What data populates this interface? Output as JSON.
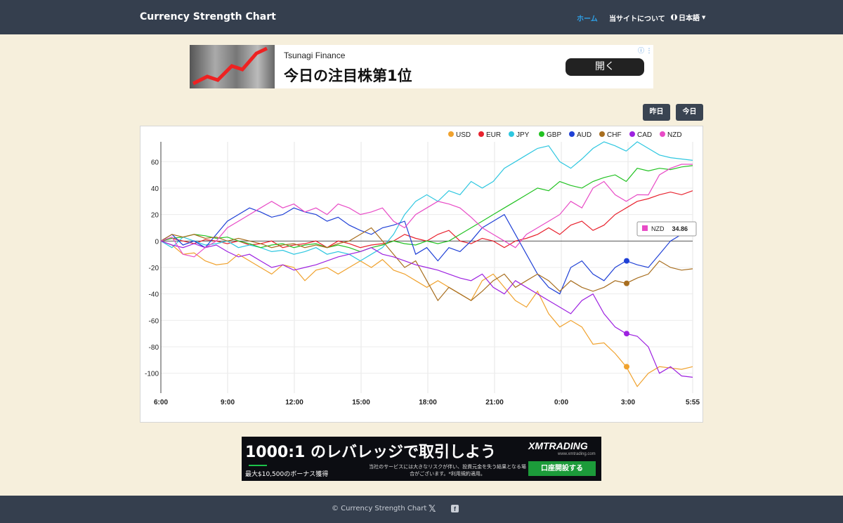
{
  "navbar": {
    "brand": "Currency Strength Chart",
    "links": [
      {
        "label": "ホーム",
        "active": true
      },
      {
        "label": "当サイトについて",
        "active": false
      }
    ],
    "language": "日本語"
  },
  "ad_top": {
    "brand": "Tsunagi Finance",
    "headline": "今日の注目株第1位",
    "button": "開く",
    "info_icon": "info-icon"
  },
  "buttons": {
    "yesterday": "昨日",
    "today": "今日"
  },
  "chart_data": {
    "type": "line",
    "x_ticks": [
      "6:00",
      "9:00",
      "12:00",
      "15:00",
      "18:00",
      "21:00",
      "0:00",
      "3:00",
      "5:55"
    ],
    "y_ticks": [
      60,
      40,
      20,
      0,
      -20,
      -40,
      -60,
      -80,
      -100
    ],
    "ylim": [
      -115,
      75
    ],
    "grid": true,
    "legend_position": "top-right",
    "tooltip": {
      "series": "NZD",
      "value": "34.86"
    },
    "series": [
      {
        "name": "USD",
        "color": "#f0a22e",
        "values": [
          0,
          -3,
          -10,
          -9,
          -15,
          -18,
          -17,
          -10,
          -15,
          -20,
          -25,
          -18,
          -20,
          -30,
          -22,
          -20,
          -25,
          -20,
          -15,
          -20,
          -14,
          -22,
          -25,
          -30,
          -35,
          -30,
          -35,
          -40,
          -45,
          -30,
          -25,
          -35,
          -45,
          -50,
          -38,
          -55,
          -65,
          -60,
          -65,
          -78,
          -77,
          -85,
          -95,
          -110,
          -100,
          -95,
          -96,
          -97,
          -95
        ]
      },
      {
        "name": "EUR",
        "color": "#e8222e",
        "values": [
          0,
          2,
          0,
          -2,
          1,
          0,
          -2,
          0,
          -3,
          -2,
          0,
          -5,
          -3,
          -2,
          0,
          -5,
          0,
          -2,
          -5,
          -3,
          -2,
          0,
          5,
          2,
          0,
          5,
          8,
          0,
          -2,
          2,
          0,
          -5,
          0,
          2,
          5,
          10,
          5,
          12,
          15,
          8,
          12,
          20,
          25,
          30,
          32,
          35,
          37,
          35,
          38
        ]
      },
      {
        "name": "JPY",
        "color": "#2ec7e0",
        "values": [
          0,
          -5,
          3,
          0,
          -3,
          -2,
          0,
          -5,
          -3,
          -5,
          -8,
          -7,
          -10,
          -8,
          -5,
          -10,
          -8,
          -10,
          -15,
          -10,
          -5,
          5,
          20,
          30,
          35,
          30,
          38,
          35,
          45,
          40,
          45,
          55,
          60,
          65,
          70,
          72,
          60,
          55,
          62,
          70,
          75,
          72,
          68,
          75,
          70,
          65,
          63,
          62,
          61
        ]
      },
      {
        "name": "GBP",
        "color": "#21c221",
        "values": [
          0,
          2,
          3,
          5,
          4,
          2,
          3,
          0,
          -2,
          -5,
          -3,
          -2,
          -5,
          -3,
          -2,
          -5,
          -3,
          -5,
          -8,
          -5,
          -3,
          0,
          -2,
          -3,
          0,
          -2,
          0,
          5,
          10,
          15,
          20,
          25,
          30,
          35,
          40,
          38,
          45,
          42,
          40,
          45,
          48,
          50,
          45,
          55,
          53,
          55,
          54,
          56,
          57
        ]
      },
      {
        "name": "AUD",
        "color": "#1f40d6",
        "values": [
          0,
          5,
          -3,
          0,
          -5,
          5,
          15,
          20,
          25,
          22,
          18,
          20,
          25,
          22,
          20,
          15,
          18,
          12,
          8,
          5,
          10,
          12,
          15,
          -10,
          -5,
          -15,
          -5,
          -8,
          0,
          10,
          15,
          20,
          5,
          -10,
          -25,
          -35,
          -40,
          -20,
          -15,
          -25,
          -30,
          -20,
          -15,
          -18,
          -20,
          -10,
          0,
          5,
          5
        ]
      },
      {
        "name": "CHF",
        "color": "#a86e1f",
        "values": [
          0,
          5,
          3,
          5,
          2,
          3,
          0,
          2,
          0,
          -2,
          -5,
          -3,
          -2,
          -5,
          -3,
          -5,
          -2,
          0,
          5,
          10,
          0,
          -10,
          -20,
          -15,
          -30,
          -45,
          -35,
          -40,
          -45,
          -38,
          -30,
          -25,
          -35,
          -30,
          -25,
          -30,
          -38,
          -30,
          -35,
          -38,
          -35,
          -30,
          -32,
          -28,
          -25,
          -15,
          -20,
          -22,
          -21
        ]
      },
      {
        "name": "CAD",
        "color": "#9d21e0",
        "values": [
          0,
          -3,
          -5,
          -2,
          -5,
          -3,
          -8,
          -12,
          -10,
          -15,
          -20,
          -18,
          -22,
          -20,
          -18,
          -15,
          -12,
          -10,
          -8,
          -5,
          -10,
          -12,
          -15,
          -18,
          -20,
          -22,
          -25,
          -28,
          -30,
          -25,
          -35,
          -40,
          -30,
          -35,
          -40,
          -45,
          -50,
          -55,
          -45,
          -40,
          -55,
          -65,
          -70,
          -72,
          -80,
          -100,
          -95,
          -102,
          -103
        ]
      },
      {
        "name": "NZD",
        "color": "#e84bc6",
        "values": [
          0,
          3,
          -10,
          -12,
          -5,
          0,
          10,
          15,
          20,
          25,
          30,
          25,
          28,
          22,
          25,
          20,
          28,
          25,
          20,
          22,
          25,
          15,
          10,
          20,
          25,
          30,
          28,
          25,
          18,
          10,
          5,
          0,
          -5,
          5,
          10,
          15,
          20,
          30,
          25,
          40,
          45,
          35,
          30,
          35,
          34.86,
          50,
          55,
          58,
          58
        ]
      }
    ]
  },
  "ad_bottom": {
    "headline": "1000:1 のレバレッジで取引しよう",
    "bonus": "最大$10,500のボーナス獲得",
    "brand": "XMTRADING",
    "brand_sub": "www.xmtrading.com",
    "note": "当社のサービスには大きなリスクが伴い、投資元金を失う結果となる場合がございます。*利用規約適用。",
    "button": "口座開設する"
  },
  "footer": {
    "copyright": "© Currency Strength Chart",
    "x_icon": "x-icon",
    "fb_icon": "facebook-icon"
  }
}
